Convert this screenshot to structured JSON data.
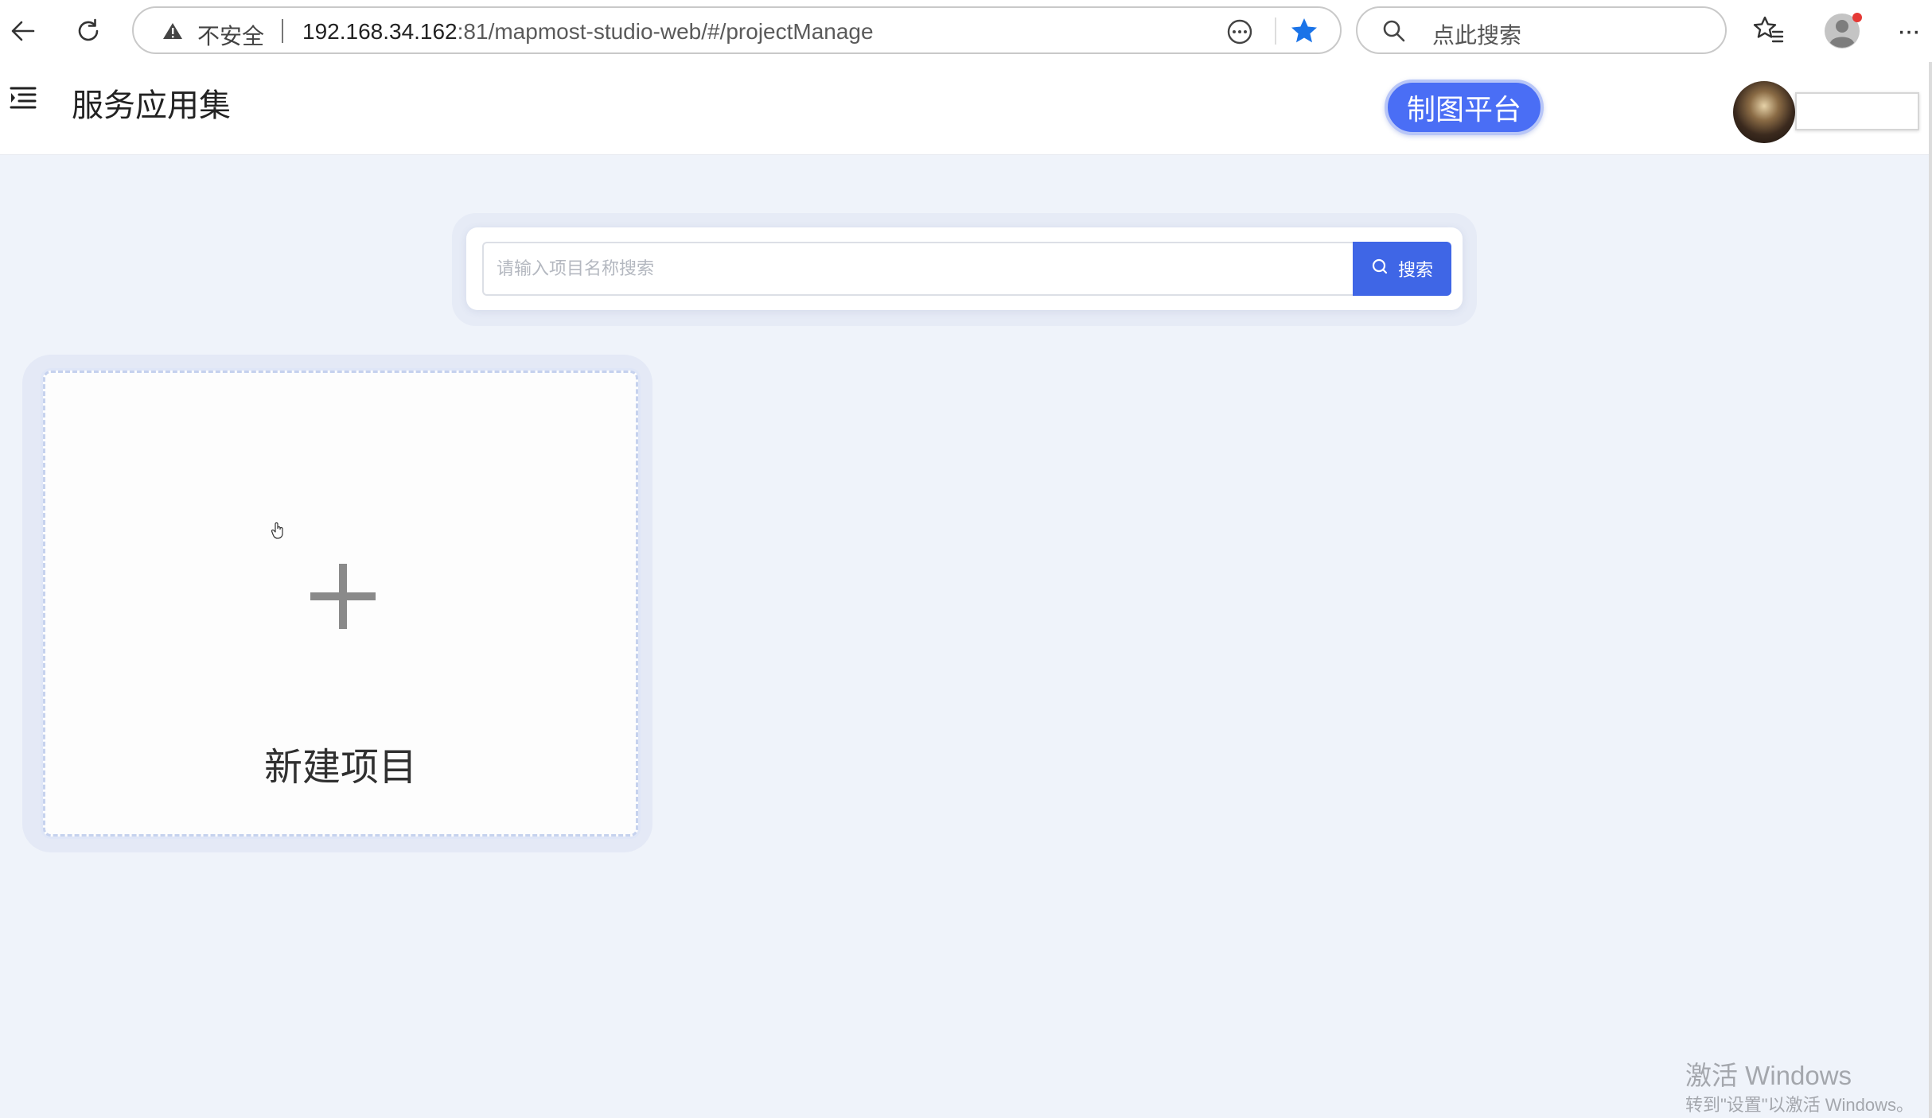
{
  "browser": {
    "security_label": "不安全",
    "url_host": "192.168.34.162",
    "url_rest": ":81/mapmost-studio-web/#/projectManage",
    "search_placeholder": "点此搜索",
    "more_label": "···",
    "icons": [
      "back-arrow-icon",
      "refresh-icon",
      "warning-icon",
      "reader-icon",
      "star-icon",
      "search-icon",
      "favorites-icon",
      "profile-icon",
      "more-icon"
    ],
    "star_color": "#1a73e8"
  },
  "header": {
    "title": "服务应用集",
    "platform_button": "制图平台",
    "accent_color": "#4a6ef5"
  },
  "search": {
    "placeholder": "请输入项目名称搜索",
    "button_label": "搜索",
    "button_color": "#3f66e6"
  },
  "new_project_card": {
    "label": "新建项目"
  },
  "watermark": {
    "title": "激活 Windows",
    "subtitle": "转到\"设置\"以激活 Windows。"
  }
}
